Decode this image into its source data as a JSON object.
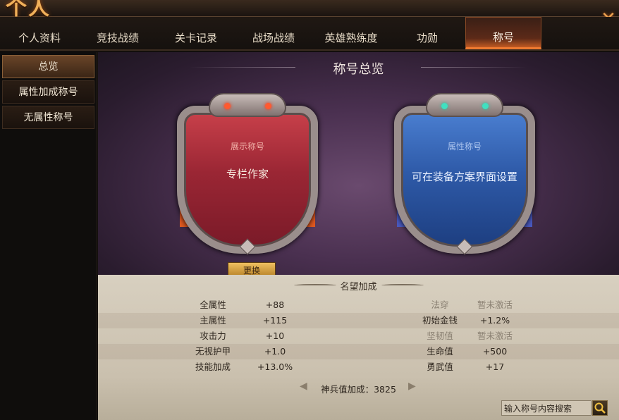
{
  "window": {
    "title": "个人",
    "close_icon": "close-icon"
  },
  "tabs": [
    {
      "label": "个人资料"
    },
    {
      "label": "竞技战绩"
    },
    {
      "label": "关卡记录"
    },
    {
      "label": "战场战绩"
    },
    {
      "label": "英雄熟练度"
    },
    {
      "label": "功勋"
    },
    {
      "label": "称号",
      "active": true
    }
  ],
  "sidebar": {
    "items": [
      {
        "label": "总览",
        "active": true
      },
      {
        "label": "属性加成称号"
      },
      {
        "label": "无属性称号"
      }
    ]
  },
  "overview": {
    "title": "称号总览",
    "display_title": {
      "band": "展示称号",
      "name": "专栏作家",
      "button": "更换"
    },
    "attribute_title": {
      "band": "属性称号",
      "name": "可在装备方案界面设置"
    }
  },
  "reputation": {
    "title": "名望加成",
    "left": [
      {
        "label": "全属性",
        "value": "+88"
      },
      {
        "label": "主属性",
        "value": "+115"
      },
      {
        "label": "攻击力",
        "value": "+10"
      },
      {
        "label": "无视护甲",
        "value": "+1.0"
      },
      {
        "label": "技能加成",
        "value": "+13.0%"
      }
    ],
    "right": [
      {
        "label": "法穿",
        "value": "暂未激活",
        "dim": true
      },
      {
        "label": "初始金钱",
        "value": "+1.2%"
      },
      {
        "label": "坚韧值",
        "value": "暂未激活",
        "dim": true
      },
      {
        "label": "生命值",
        "value": "+500"
      },
      {
        "label": "勇武值",
        "value": "+17"
      }
    ],
    "bonus_text": "神兵值加成：3825"
  },
  "search": {
    "placeholder": "输入称号内容搜索",
    "icon": "search-icon"
  },
  "colors": {
    "accent": "#f07a30",
    "red_shield": "#9a2634",
    "blue_shield": "#2e5aa8"
  }
}
